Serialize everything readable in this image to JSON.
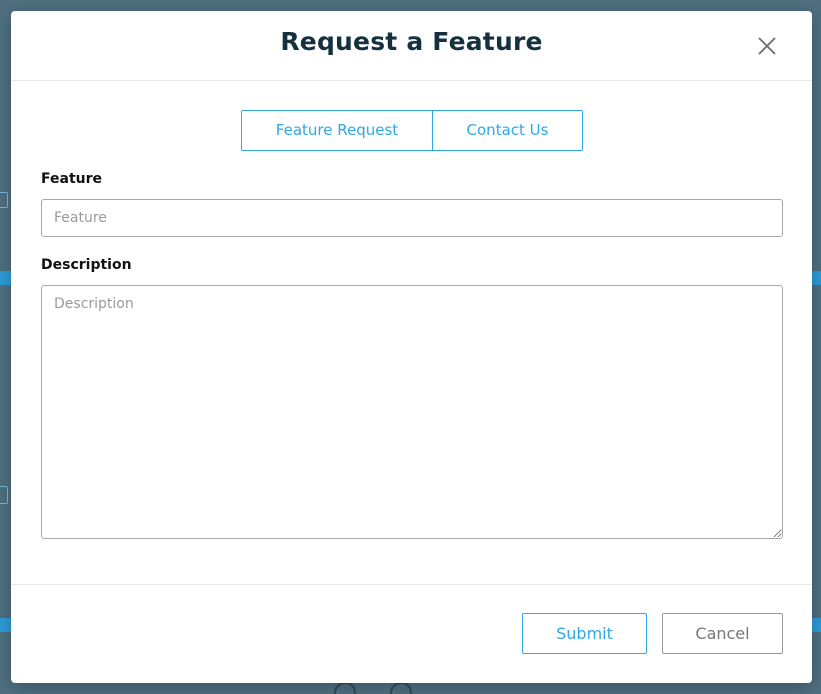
{
  "modal": {
    "title": "Request a Feature"
  },
  "tabs": [
    {
      "label": "Feature Request"
    },
    {
      "label": "Contact Us"
    }
  ],
  "form": {
    "feature": {
      "label": "Feature",
      "placeholder": "Feature",
      "value": ""
    },
    "description": {
      "label": "Description",
      "placeholder": "Description",
      "value": ""
    }
  },
  "footer": {
    "submit_label": "Submit",
    "cancel_label": "Cancel"
  },
  "colors": {
    "accent": "#2ea8e6",
    "title": "#15303e",
    "backdrop": "#4f6f7f"
  },
  "icons": {
    "close": "close-icon"
  }
}
